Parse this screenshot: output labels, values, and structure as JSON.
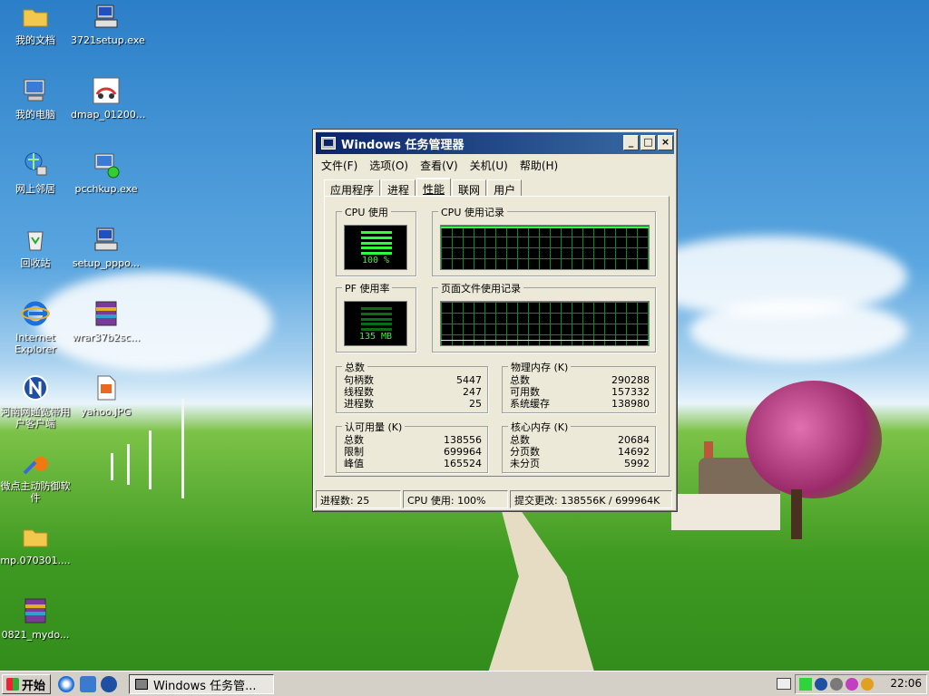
{
  "desktop": {
    "icons": [
      {
        "label": "我的文档"
      },
      {
        "label": "3721setup.exe"
      },
      {
        "label": "我的电脑"
      },
      {
        "label": "dmap_01200..."
      },
      {
        "label": "网上邻居"
      },
      {
        "label": "pcchkup.exe"
      },
      {
        "label": "回收站"
      },
      {
        "label": "setup_pppo..."
      },
      {
        "label": "Internet Explorer"
      },
      {
        "label": "wrar37b2sc..."
      },
      {
        "label": "河南网通宽带用户客户端"
      },
      {
        "label": "yahoo.JPG"
      },
      {
        "label": "微点主动防御软件"
      },
      {
        "label": "mp.070301...."
      },
      {
        "label": "0821_mydo..."
      }
    ]
  },
  "window": {
    "title": "Windows 任务管理器",
    "menu": [
      "文件(F)",
      "选项(O)",
      "查看(V)",
      "关机(U)",
      "帮助(H)"
    ],
    "tabs": [
      "应用程序",
      "进程",
      "性能",
      "联网",
      "用户"
    ],
    "active_tab": "性能",
    "perf": {
      "cpu_usage_title": "CPU 使用",
      "cpu_usage_value": "100 %",
      "cpu_usage_percent": 100,
      "cpu_history_title": "CPU 使用记录",
      "pf_usage_title": "PF 使用率",
      "pf_usage_value": "135 MB",
      "pf_history_title": "页面文件使用记录",
      "totals": {
        "title": "总数",
        "rows": [
          {
            "label": "句柄数",
            "value": "5447"
          },
          {
            "label": "线程数",
            "value": "247"
          },
          {
            "label": "进程数",
            "value": "25"
          }
        ]
      },
      "physical": {
        "title": "物理内存 (K)",
        "rows": [
          {
            "label": "总数",
            "value": "290288"
          },
          {
            "label": "可用数",
            "value": "157332"
          },
          {
            "label": "系统缓存",
            "value": "138980"
          }
        ]
      },
      "commit": {
        "title": "认可用量 (K)",
        "rows": [
          {
            "label": "总数",
            "value": "138556"
          },
          {
            "label": "限制",
            "value": "699964"
          },
          {
            "label": "峰值",
            "value": "165524"
          }
        ]
      },
      "kernel": {
        "title": "核心内存 (K)",
        "rows": [
          {
            "label": "总数",
            "value": "20684"
          },
          {
            "label": "分页数",
            "value": "14692"
          },
          {
            "label": "未分页",
            "value": "5992"
          }
        ]
      }
    },
    "status": {
      "processes": "进程数: 25",
      "cpu": "CPU 使用: 100%",
      "commit": "提交更改: 138556K / 699964K"
    }
  },
  "taskbar": {
    "start_label": "开始",
    "task_button": "Windows 任务管...",
    "clock": "22:06"
  }
}
